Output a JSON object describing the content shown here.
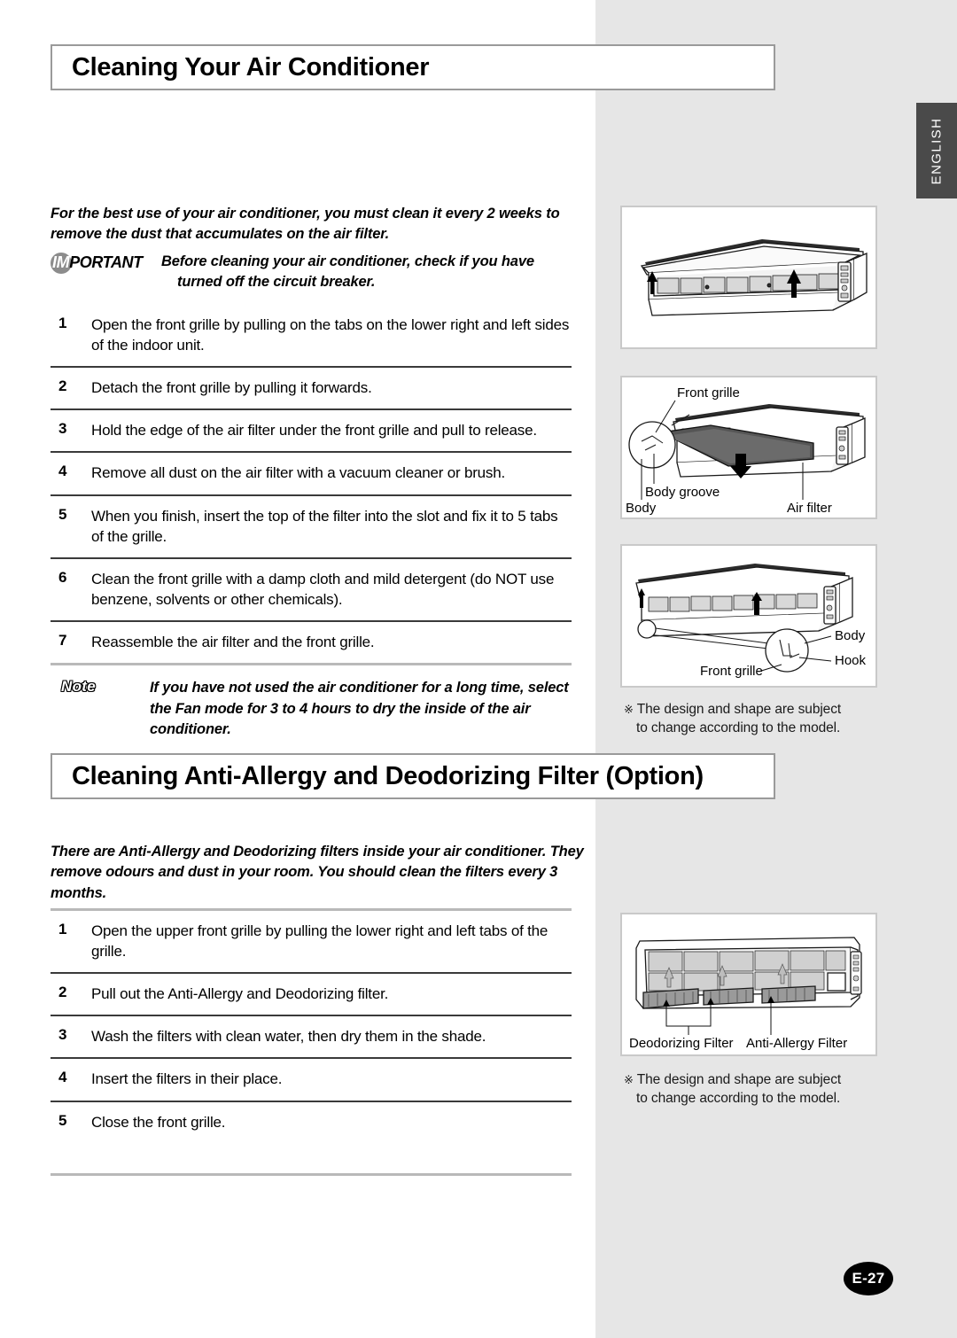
{
  "page": {
    "language_tab": "ENGLISH",
    "page_number": "E-27"
  },
  "section1": {
    "title": "Cleaning Your Air Conditioner",
    "lead": "For the best use of your air conditioner, you must clean it every 2 weeks to remove the dust that accumulates on the air filter.",
    "important": {
      "label_highlight": "IM",
      "label_rest": "PORTANT",
      "line1": "Before cleaning your air conditioner, check if you have",
      "line2": "turned off the circuit breaker."
    },
    "steps": [
      {
        "num": "1",
        "text": "Open the front grille by pulling on the tabs on the lower right and left sides of the indoor unit."
      },
      {
        "num": "2",
        "text": "Detach the front grille by pulling it forwards."
      },
      {
        "num": "3",
        "text": "Hold the edge of the air filter under the front grille and pull to release."
      },
      {
        "num": "4",
        "text": "Remove all dust on the air filter with a vacuum cleaner or brush."
      },
      {
        "num": "5",
        "text": "When you finish, insert the top of the filter into the slot and fix it to 5 tabs of the grille."
      },
      {
        "num": "6",
        "text": "Clean the front grille with a damp cloth and mild detergent (do NOT use benzene, solvents or other chemicals)."
      },
      {
        "num": "7",
        "text": "Reassemble the air filter and the front grille."
      }
    ],
    "note": {
      "label": "Note",
      "text": "If you have not used the air conditioner for a long time, select the Fan mode for 3 to 4 hours to dry the inside of the air conditioner."
    },
    "figures": {
      "fig1_labels": [],
      "fig2_labels": [
        "Front grille",
        "Body groove",
        "Body",
        "Air filter"
      ],
      "fig3_labels": [
        "Body",
        "Hook",
        "Front grille"
      ],
      "caption_mark": "※",
      "caption_line1": "The design and shape are subject",
      "caption_line2": "to change according to the model."
    }
  },
  "section2": {
    "title": "Cleaning Anti-Allergy and Deodorizing Filter (Option)",
    "lead": "There are Anti-Allergy and Deodorizing filters inside your air conditioner. They remove odours and dust in your room. You should clean the filters every 3 months.",
    "steps": [
      {
        "num": "1",
        "text": "Open the upper front grille by pulling the lower right and left tabs of the grille."
      },
      {
        "num": "2",
        "text": "Pull out the Anti-Allergy and Deodorizing filter."
      },
      {
        "num": "3",
        "text": "Wash the filters with clean water, then dry them in the shade."
      },
      {
        "num": "4",
        "text": "Insert the filters in their place."
      },
      {
        "num": "5",
        "text": "Close the front grille."
      }
    ],
    "figures": {
      "fig4_labels": [
        "Deodorizing Filter",
        "Anti-Allergy Filter"
      ],
      "caption_mark": "※",
      "caption_line1": "The design and shape are subject",
      "caption_line2": "to change according to the model."
    }
  },
  "figure_labels": {
    "front_grille": "Front grille",
    "body_groove": "Body groove",
    "body": "Body",
    "air_filter": "Air filter",
    "hook": "Hook",
    "deodorizing_filter": "Deodorizing Filter",
    "anti_allergy_filter": "Anti-Allergy Filter"
  }
}
